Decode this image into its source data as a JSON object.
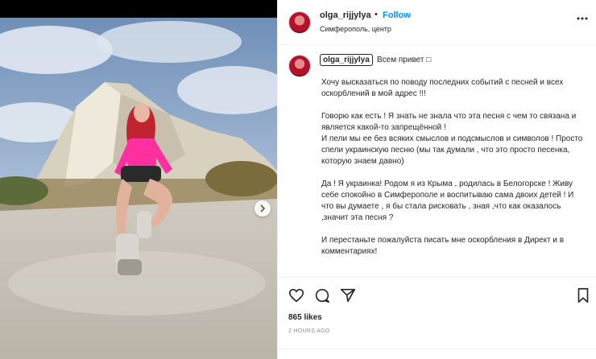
{
  "post": {
    "username": "olga_rijjylya",
    "separator": "•",
    "follow_label": "Follow",
    "location": "Симферополь, центр"
  },
  "caption": {
    "username": "olga_rijjylya",
    "greeting": "Всем привет □",
    "body": "Хочу высказаться по поводу последних событий с песней и всех оскорблений в мой адрес !!!\n\nГоворю как есть ! Я знать не знала что эта песня с чем то связана и является какой-то запрещённой !\nИ пели мы ее без всяких смыслов и подсмыслов и символов ! Просто спели украинскую песню (мы так думали , что это просто песенка, которую знаем давно)\n\nДа ! Я украинка! Родом я из Крыма , родилась в Белогорске ! Живу себе спокойно в Симферополе и воспитываю сама двоих детей ! И что вы думаете , я бы стала рисковать , зная ,что как оказалось ,значит эта песня ?\n\nИ перестаньте пожалуйста писать мне оскорбления в Директ и в комментариях!"
  },
  "stats": {
    "likes": "865 likes",
    "time": "2 HOURS AGO"
  },
  "icons": {
    "more": "more-options-icon",
    "like": "heart-icon",
    "comment": "comment-icon",
    "share": "share-icon",
    "save": "bookmark-icon",
    "next": "chevron-right-icon"
  },
  "colors": {
    "follow": "#0095f6",
    "text": "#262626",
    "muted": "#8e8e8e"
  }
}
